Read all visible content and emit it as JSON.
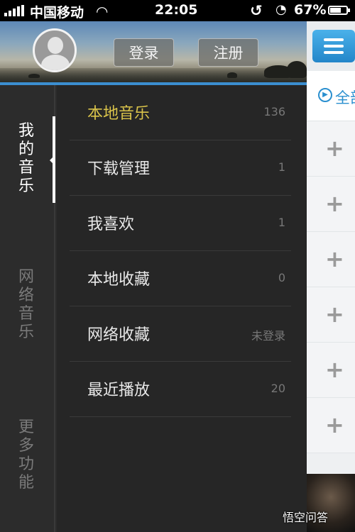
{
  "status_bar": {
    "carrier": "中国移动",
    "time": "22:05",
    "battery_percent": "67%",
    "battery_level": 0.67
  },
  "header": {
    "login_label": "登录",
    "register_label": "注册"
  },
  "categories": [
    {
      "label": "我的音乐",
      "active": true
    },
    {
      "label": "网络音乐",
      "active": false
    },
    {
      "label": "更多功能",
      "active": false
    }
  ],
  "menu": {
    "items": [
      {
        "label": "本地音乐",
        "count": "136",
        "active": true
      },
      {
        "label": "下载管理",
        "count": "1"
      },
      {
        "label": "我喜欢",
        "count": "1"
      },
      {
        "label": "本地收藏",
        "count": "0"
      },
      {
        "label": "网络收藏",
        "count": "未登录"
      },
      {
        "label": "最近播放",
        "count": "20"
      }
    ]
  },
  "right_panel": {
    "subbar_text": "全部",
    "accent": "#2a8fcf"
  },
  "watermark": "悟空问答",
  "colors": {
    "active_item": "#d9c34a",
    "accent_line": "#3b8ed0"
  },
  "icons": [
    "signal-icon",
    "wifi-icon",
    "rotation-lock-icon",
    "alarm-icon",
    "battery-icon",
    "hamburger-menu-icon",
    "play-circle-icon",
    "plus-icon",
    "default-avatar-icon"
  ]
}
